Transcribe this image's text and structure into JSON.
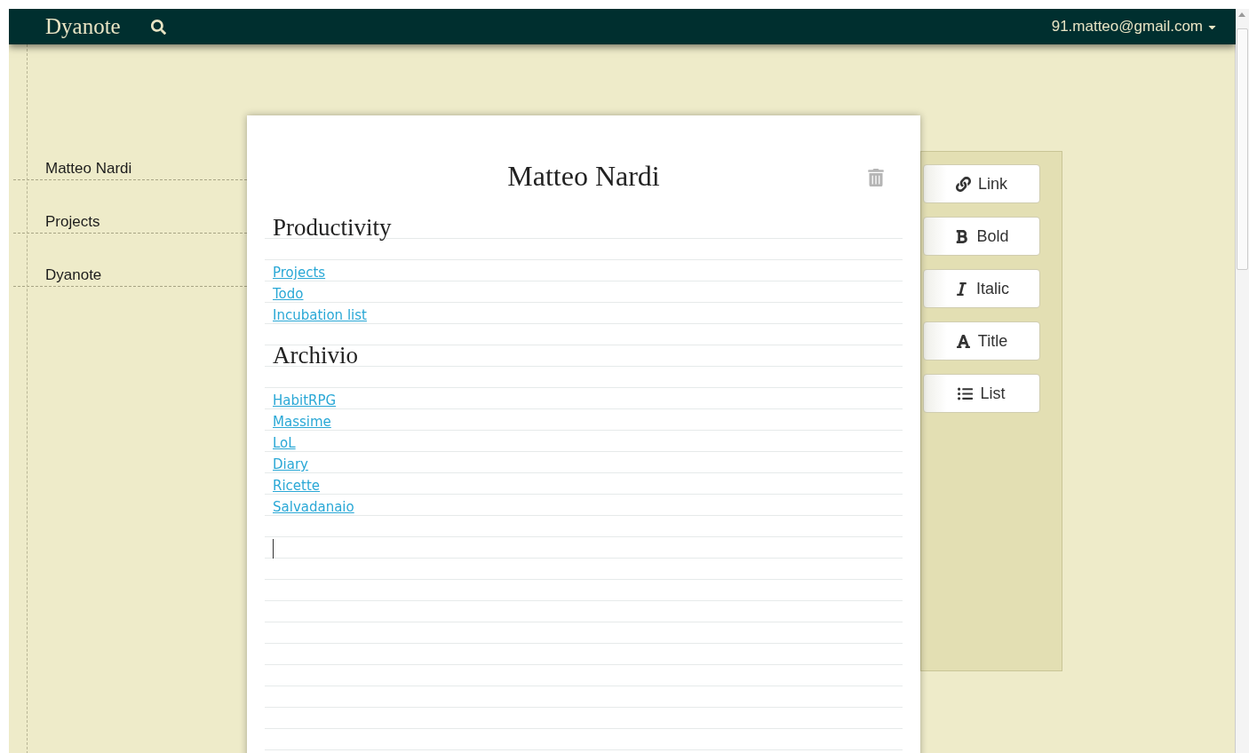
{
  "navbar": {
    "brand": "Dyanote",
    "account": "91.matteo@gmail.com"
  },
  "breadcrumbs": [
    "Matteo Nardi",
    "Projects",
    "Dyanote"
  ],
  "note": {
    "title": "Matteo Nardi",
    "blocks": [
      {
        "kind": "heading",
        "text": "Productivity"
      },
      {
        "kind": "links",
        "items": [
          "Projects",
          "Todo",
          "Incubation list"
        ]
      },
      {
        "kind": "heading",
        "text": "Archivio"
      },
      {
        "kind": "links",
        "items": [
          "HabitRPG",
          "Massime",
          "LoL",
          "Diary",
          "Ricette",
          "Salvadanaio"
        ]
      }
    ]
  },
  "toolbar": [
    {
      "kind": "link",
      "label": "Link"
    },
    {
      "kind": "bold",
      "label": "Bold"
    },
    {
      "kind": "italic",
      "label": "Italic"
    },
    {
      "kind": "title",
      "label": "Title"
    },
    {
      "kind": "list",
      "label": "List"
    }
  ]
}
